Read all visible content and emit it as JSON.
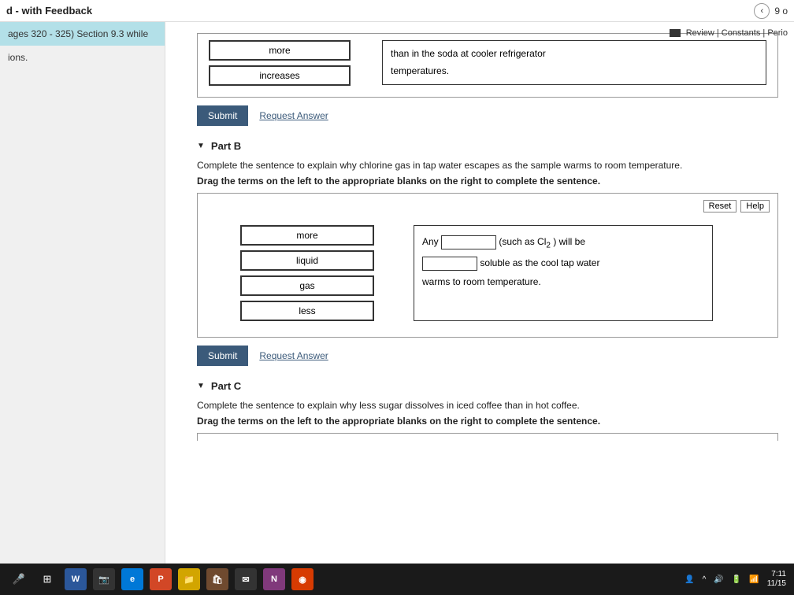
{
  "header": {
    "title": "d - with Feedback",
    "nav_count": "9 o"
  },
  "top_links": {
    "review": "Review",
    "constants": "Constants",
    "periodic": "Perio"
  },
  "sidebar": {
    "highlight": "ages 320 - 325) Section 9.3 while",
    "text": "ions."
  },
  "partA": {
    "tiles": [
      "more",
      "increases"
    ],
    "sentence_1": "than in the soda at cooler refrigerator",
    "sentence_2": "temperatures.",
    "submit": "Submit",
    "request": "Request Answer"
  },
  "partB": {
    "title": "Part B",
    "desc": "Complete the sentence to explain why chlorine gas in tap water escapes as the sample warms to room temperature.",
    "instr": "Drag the terms on the left to the appropriate blanks on the right to complete the sentence.",
    "reset": "Reset",
    "help": "Help",
    "tiles": [
      "more",
      "liquid",
      "gas",
      "less"
    ],
    "s1a": "Any",
    "s1b": "(such as Cl",
    "s1c": ") will be",
    "s2": "soluble as the cool tap water",
    "s3": "warms to room temperature.",
    "submit": "Submit",
    "request": "Request Answer"
  },
  "partC": {
    "title": "Part C",
    "desc": "Complete the sentence to explain why less sugar dissolves in iced coffee than in hot coffee.",
    "instr": "Drag the terms on the left to the appropriate blanks on the right to complete the sentence."
  },
  "taskbar": {
    "time": "7:11",
    "date": "11/15"
  }
}
